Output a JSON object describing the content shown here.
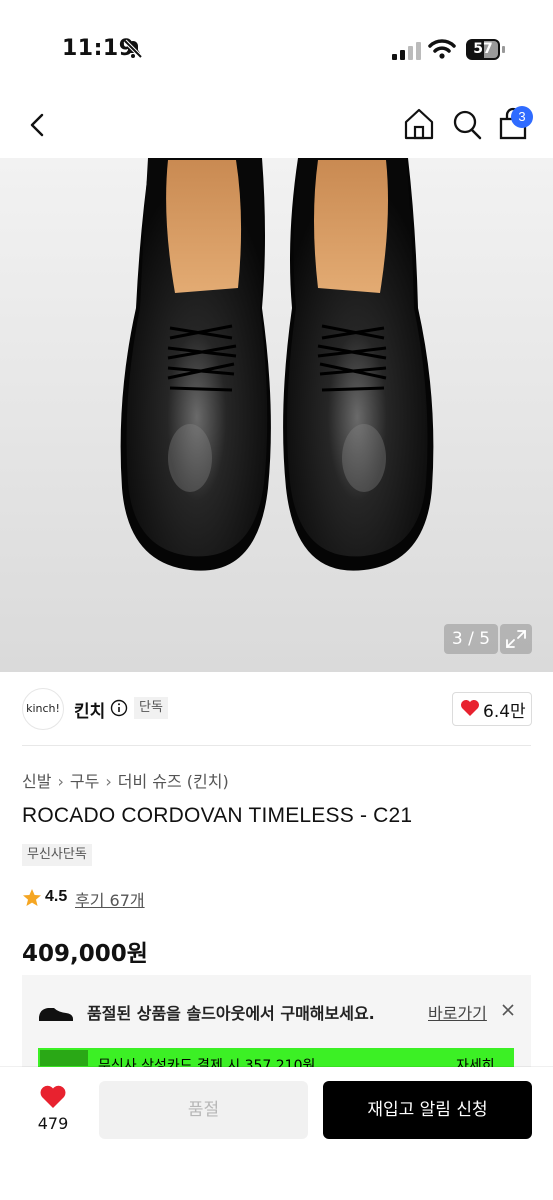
{
  "status_bar": {
    "time": "11:19",
    "battery": "57"
  },
  "nav": {
    "cart_count": "3"
  },
  "gallery": {
    "counter": "3 / 5"
  },
  "brand": {
    "logo_text": "kinch!",
    "name": "킨치",
    "exclusive_tag": "단독",
    "likes": "6.4만"
  },
  "breadcrumb": [
    "신발",
    "구두",
    "더비 슈즈 (킨치)"
  ],
  "product": {
    "title": "ROCADO CORDOVAN TIMELESS - C21",
    "exclusive_label": "무신사단독",
    "rating": "4.5",
    "reviews": "후기 67개",
    "price": "409,000원"
  },
  "soldout_banner": {
    "text": "품절된 상품을 솔드아웃에서 구매해보세요.",
    "link": "바로가기"
  },
  "promo": {
    "text": "무신사 삼성카드 결제 시 357,210원",
    "more": "자세히"
  },
  "bottom_bar": {
    "fav_count": "479",
    "soldout_button": "품절",
    "restock_button": "재입고 알림 신청"
  },
  "colors": {
    "accent": "#2f6bff",
    "heart": "#e8222f",
    "promo": "#3cf025",
    "star": "#f5a623"
  }
}
